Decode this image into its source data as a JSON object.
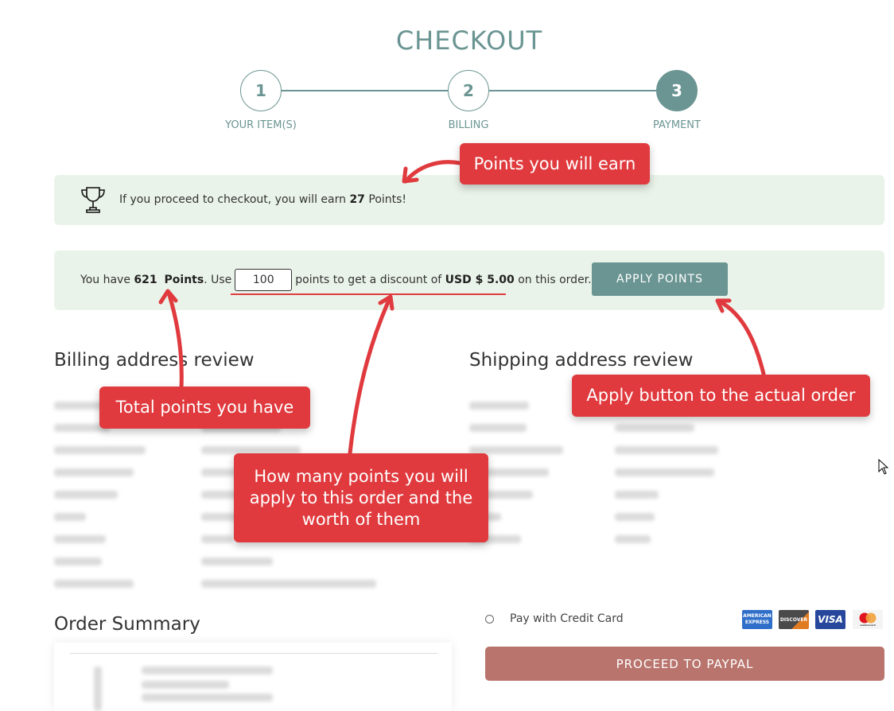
{
  "page": {
    "title": "CHECKOUT"
  },
  "steps": [
    {
      "num": "1",
      "label": "YOUR ITEM(S)"
    },
    {
      "num": "2",
      "label": "BILLING"
    },
    {
      "num": "3",
      "label": "PAYMENT",
      "active": true
    }
  ],
  "earn": {
    "icon": "trophy-icon",
    "text_before": "If you proceed to checkout, you will earn ",
    "points": "27",
    "text_after": " Points!"
  },
  "redeem": {
    "you_have": "You have ",
    "points": "621",
    "points_label": "Points",
    "use": ". Use",
    "input_value": "100",
    "mid": "points to get a discount of ",
    "discount": "USD $ 5.00",
    "after": " on this order.",
    "apply_label": "APPLY POINTS"
  },
  "billing": {
    "heading": "Billing address review"
  },
  "shipping": {
    "heading": "Shipping address review"
  },
  "order": {
    "heading": "Order Summary"
  },
  "payment": {
    "option_label": "Pay with Credit Card",
    "cards": [
      "AMERICAN EXPRESS",
      "DISCOVER",
      "VISA",
      "mastercard"
    ],
    "paypal_label": "PROCEED TO PAYPAL"
  },
  "callouts": {
    "earn": "Points you will earn",
    "total": "Total points you have",
    "apply": "Apply button to the actual order",
    "howmany": "How many points you will apply to this order and the worth of them"
  },
  "colors": {
    "accent": "#6a9592",
    "callout": "#e03a3e",
    "paypal": "#b9756d",
    "box": "#eaf3e9"
  }
}
